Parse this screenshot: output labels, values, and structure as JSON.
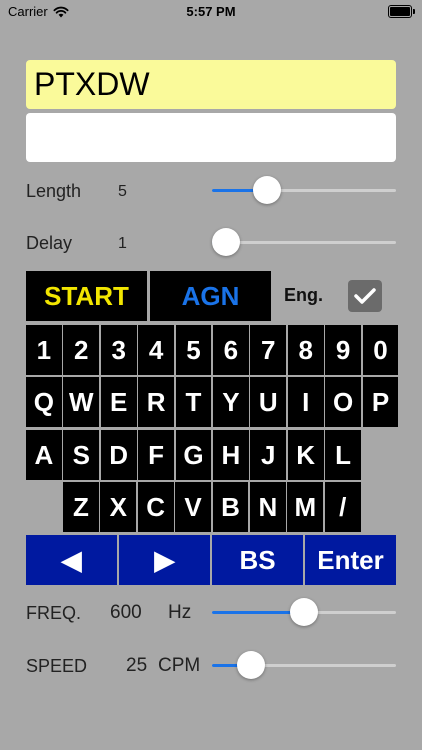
{
  "status_bar": {
    "carrier": "Carrier",
    "time": "5:57 PM"
  },
  "display": {
    "input_text": "PTXDW",
    "output_text": ""
  },
  "length": {
    "label": "Length",
    "value": "5",
    "fraction": 0.26
  },
  "delay": {
    "label": "Delay",
    "value": "1",
    "fraction": 0.0
  },
  "controls": {
    "start_label": "START",
    "again_label": "AGN",
    "eng_label": "Eng.",
    "eng_checked": true
  },
  "keyboard": {
    "rows": [
      [
        "1",
        "2",
        "3",
        "4",
        "5",
        "6",
        "7",
        "8",
        "9",
        "0"
      ],
      [
        "Q",
        "W",
        "E",
        "R",
        "T",
        "Y",
        "U",
        "I",
        "O",
        "P"
      ],
      [
        "A",
        "S",
        "D",
        "F",
        "G",
        "H",
        "J",
        "K",
        "L"
      ],
      [
        "Z",
        "X",
        "C",
        "V",
        "B",
        "N",
        "M",
        "/"
      ]
    ],
    "function_keys": [
      {
        "label": "◀",
        "name": "left-key"
      },
      {
        "label": "▶",
        "name": "right-key"
      },
      {
        "label": "BS",
        "name": "backspace-key"
      },
      {
        "label": "Enter",
        "name": "enter-key"
      }
    ]
  },
  "frequency": {
    "label": "FREQ.",
    "value": "600",
    "unit": "Hz",
    "fraction": 0.5
  },
  "speed": {
    "label": "SPEED",
    "value": "25",
    "unit": "CPM",
    "fraction": 0.16
  },
  "colors": {
    "background": "#a8a8a8",
    "input_yellow": "#fafa9a",
    "start_yellow": "#f2e600",
    "accent_blue": "#1a73e8",
    "function_key_blue": "#0019a0",
    "key_black": "#000000"
  }
}
